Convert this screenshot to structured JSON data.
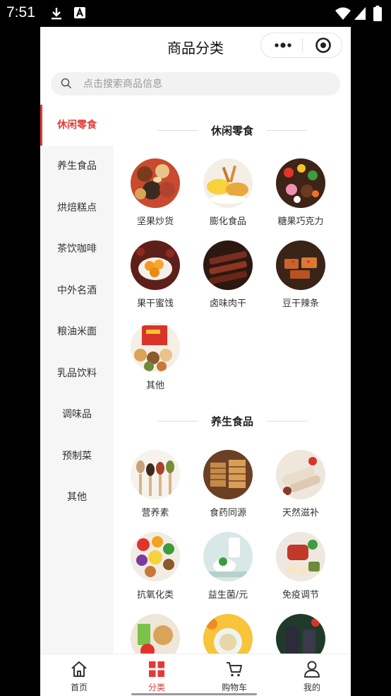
{
  "status_bar": {
    "time": "7:51"
  },
  "header": {
    "title": "商品分类"
  },
  "search": {
    "placeholder": "点击搜索商品信息"
  },
  "sidebar": {
    "items": [
      {
        "label": "休闲零食",
        "active": true
      },
      {
        "label": "养生食品"
      },
      {
        "label": "烘焙糕点"
      },
      {
        "label": "茶饮咖啡"
      },
      {
        "label": "中外名酒"
      },
      {
        "label": "粮油米面"
      },
      {
        "label": "乳品饮料"
      },
      {
        "label": "调味品"
      },
      {
        "label": "预制菜"
      },
      {
        "label": "其他"
      }
    ]
  },
  "sections": [
    {
      "title": "休闲零食",
      "items": [
        "坚果炒货",
        "膨化食品",
        "糖果巧克力",
        "果干蜜饯",
        "卤味肉干",
        "豆干辣条",
        "其他"
      ]
    },
    {
      "title": "养生食品",
      "items": [
        "营养素",
        "食药同源",
        "天然滋补",
        "抗氧化类",
        "益生菌/元",
        "免疫调节"
      ]
    }
  ],
  "tabbar": {
    "tabs": [
      {
        "label": "首页"
      },
      {
        "label": "分类",
        "active": true
      },
      {
        "label": "购物车"
      },
      {
        "label": "我的"
      }
    ]
  },
  "colors": {
    "accent": "#e53935",
    "sidebar_bg": "#f6f6f6",
    "search_bg": "#f2f2f2"
  }
}
